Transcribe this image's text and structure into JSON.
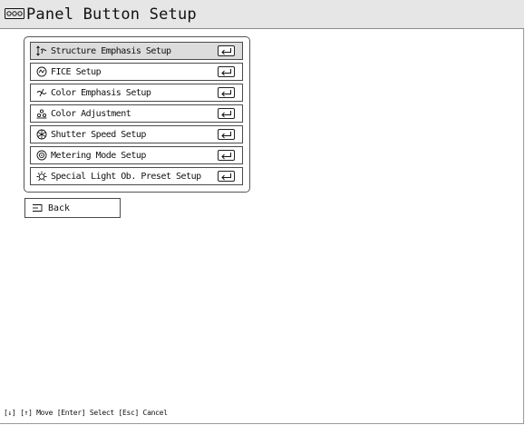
{
  "window": {
    "title": "Panel Button Setup"
  },
  "menu": {
    "items": [
      {
        "label": "Structure Emphasis Setup",
        "icon": "structure-emphasis-icon",
        "selected": true
      },
      {
        "label": "FICE Setup",
        "icon": "fice-icon",
        "selected": false
      },
      {
        "label": "Color Emphasis Setup",
        "icon": "color-emphasis-icon",
        "selected": false
      },
      {
        "label": "Color Adjustment",
        "icon": "color-adjustment-icon",
        "selected": false
      },
      {
        "label": "Shutter Speed Setup",
        "icon": "shutter-speed-icon",
        "selected": false
      },
      {
        "label": "Metering Mode Setup",
        "icon": "metering-mode-icon",
        "selected": false
      },
      {
        "label": "Special Light Ob. Preset Setup",
        "icon": "special-light-icon",
        "selected": false
      }
    ]
  },
  "back": {
    "label": "Back"
  },
  "status_bar": {
    "text": "[↓] [↑] Move  [Enter] Select  [Esc] Cancel"
  },
  "colors": {
    "title_bar_bg": "#e6e6e6",
    "selected_item_bg": "#dcdcdc",
    "border": "#4a4a4a"
  }
}
